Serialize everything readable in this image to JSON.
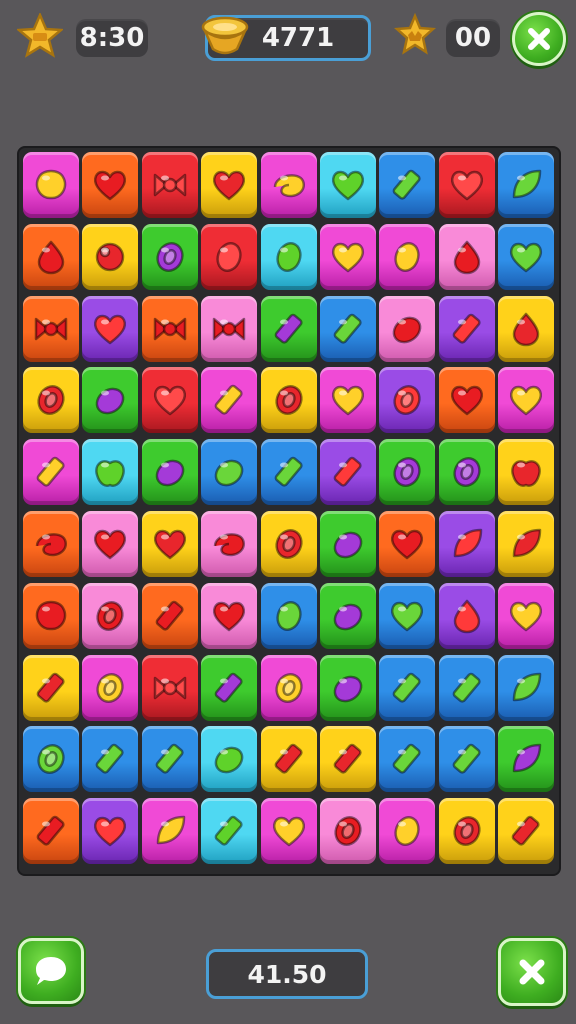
{
  "hud": {
    "time": "8:30",
    "coins": "4771",
    "stars": "00",
    "bottom_value": "41.50"
  },
  "icons": {
    "left": "star-badge-icon",
    "coins": "coin-stack-icon",
    "stars": "crown-star-icon",
    "close": "close-icon",
    "chat": "chat-bubble-icon"
  },
  "colors": {
    "background": "#59575a",
    "board": "#2a2a2c",
    "button_green": "#3fae21"
  },
  "board": {
    "rows": 10,
    "cols": 9,
    "tiles": [
      [
        "magenta:blob",
        "orange:heart",
        "red:bow",
        "yellow:heart",
        "magenta:swirl",
        "cyan:heart",
        "blue:bar",
        "red:heart",
        "blue:leaf"
      ],
      [
        "orange:drop",
        "yellow:orb",
        "green:ring",
        "red:oval",
        "cyan:oval",
        "magenta:heart",
        "magenta:oval",
        "pink:drop",
        "blue:heart"
      ],
      [
        "orange:bow",
        "purple:heart",
        "orange:bow",
        "pink:bow",
        "green:bar",
        "blue:bar",
        "pink:lemon",
        "purple:bar",
        "yellow:drop"
      ],
      [
        "yellow:ring",
        "green:lemon",
        "red:heart",
        "magenta:bar",
        "yellow:ring",
        "magenta:heart",
        "purple:ring",
        "orange:heart",
        "magenta:heart"
      ],
      [
        "magenta:bar",
        "cyan:apple",
        "green:lemon",
        "blue:lemon",
        "blue:bar",
        "purple:bar",
        "green:ring",
        "green:ring",
        "yellow:apple"
      ],
      [
        "orange:swirl",
        "pink:heart",
        "yellow:heart",
        "pink:swirl",
        "yellow:ring",
        "green:lemon",
        "orange:heart",
        "purple:leaf",
        "yellow:leaf"
      ],
      [
        "orange:blob",
        "pink:ring",
        "orange:bar",
        "pink:heart",
        "blue:oval",
        "green:lemon",
        "blue:heart",
        "purple:drop",
        "magenta:heart"
      ],
      [
        "yellow:bar",
        "magenta:ring",
        "red:bow",
        "green:bar",
        "magenta:ring",
        "green:lemon",
        "blue:bar",
        "blue:bar",
        "blue:leaf"
      ],
      [
        "blue:ring",
        "blue:bar",
        "blue:bar",
        "cyan:lemon",
        "yellow:bar",
        "yellow:bar",
        "blue:bar",
        "blue:bar",
        "green:leaf"
      ],
      [
        "orange:bar",
        "purple:heart",
        "magenta:leaf",
        "cyan:bar",
        "magenta:heart",
        "pink:ring",
        "magenta:oval",
        "yellow:ring",
        "yellow:bar"
      ]
    ]
  }
}
